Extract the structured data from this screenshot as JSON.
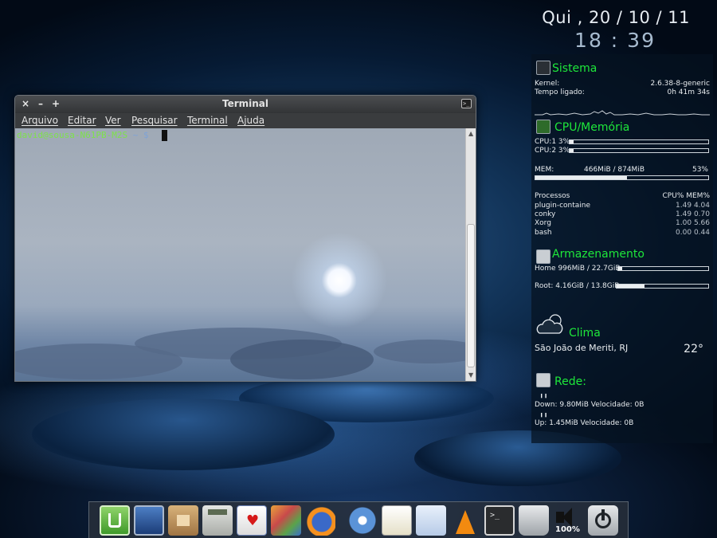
{
  "clock": {
    "date": "Qui , 20 / 10 / 11",
    "time": "18 : 39"
  },
  "conky": {
    "system": {
      "title": "Sistema",
      "kernel_label": "Kernel:",
      "kernel_value": "2.6.38-8-generic",
      "uptime_label": "Tempo ligado:",
      "uptime_value": "0h 41m 34s"
    },
    "cpu_mem": {
      "title": "CPU/Memória",
      "cpu1_label": "CPU:1 3%",
      "cpu1_percent": 3,
      "cpu2_label": "CPU:2 3%",
      "cpu2_percent": 3,
      "mem_label": "MEM:",
      "mem_value": "466MiB / 874MiB",
      "mem_percent_label": "53%",
      "mem_percent": 53
    },
    "processes": {
      "header_name": "Processos",
      "header_stats": "CPU% MEM%",
      "rows": [
        {
          "name": "plugin-containe",
          "stats": "1.49 4.04"
        },
        {
          "name": "conky",
          "stats": "1.49 0.70"
        },
        {
          "name": "Xorg",
          "stats": "1.00 5.66"
        },
        {
          "name": "bash",
          "stats": "0.00 0.44"
        }
      ]
    },
    "storage": {
      "title": "Armazenamento",
      "home_label": "Home 996MiB / 22.7GiB",
      "home_percent": 4,
      "root_label": "Root: 4.16GiB / 13.8GiB",
      "root_percent": 30
    },
    "weather": {
      "title": "Clima",
      "city": "São João de Meriti, RJ",
      "temp": "22°",
      "icon": "cloud-sun-icon"
    },
    "network": {
      "title": "Rede:",
      "down": "Down: 9.80MiB Velocidade: 0B",
      "up": "Up: 1.45MiB Velocidade: 0B"
    }
  },
  "terminal": {
    "title": "Terminal",
    "menu": [
      "Arquivo",
      "Editar",
      "Ver",
      "Pesquisar",
      "Terminal",
      "Ajuda"
    ],
    "prompt_user": "david@sousa-N61PB-M2S",
    "prompt_path": " ~ $ "
  },
  "dock": {
    "items": [
      {
        "name": "mint-menu-icon"
      },
      {
        "name": "desktop-icon"
      },
      {
        "name": "home-folder-icon"
      },
      {
        "name": "calculator-icon"
      },
      {
        "name": "solitaire-icon"
      },
      {
        "name": "paint-icon"
      },
      {
        "name": "firefox-icon"
      },
      {
        "name": "chromium-icon"
      },
      {
        "name": "text-editor-icon"
      },
      {
        "name": "openoffice-icon"
      },
      {
        "name": "vlc-icon"
      },
      {
        "name": "terminal-icon"
      },
      {
        "name": "trash-icon"
      },
      {
        "name": "volume-icon"
      },
      {
        "name": "power-icon"
      }
    ],
    "volume_label": "100%"
  }
}
